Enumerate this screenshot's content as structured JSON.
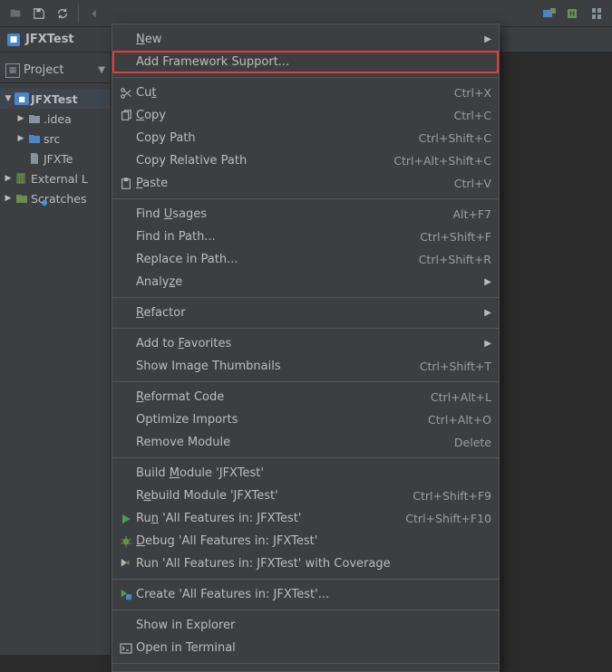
{
  "toolbar": {
    "right": [
      {
        "name": "tool-a"
      },
      {
        "name": "tool-b"
      },
      {
        "name": "tool-c"
      }
    ]
  },
  "breadcrumb": {
    "project": "JFXTest"
  },
  "sidebar": {
    "header": "Project",
    "tree": [
      {
        "label": "JFXTest",
        "kind": "module",
        "depth": 0,
        "expanded": true,
        "bold": true
      },
      {
        "label": ".idea",
        "kind": "folder",
        "depth": 1,
        "expanded": false
      },
      {
        "label": "src",
        "kind": "folder-src",
        "depth": 1,
        "expanded": false
      },
      {
        "label": "JFXTe",
        "kind": "file",
        "depth": 1
      },
      {
        "label": "External L",
        "kind": "libs",
        "depth": 0,
        "expanded": false
      },
      {
        "label": "Scratches",
        "kind": "scratch",
        "depth": 0,
        "expanded": false
      }
    ]
  },
  "contextMenu": {
    "items": [
      {
        "label": "New",
        "mnemonic": "N",
        "submenu": true
      },
      {
        "label": "Add Framework Support...",
        "highlighted": true
      },
      "sep",
      {
        "icon": "scissors",
        "label": "Cut",
        "mnemonic": "t",
        "shortcut": "Ctrl+X"
      },
      {
        "icon": "copy",
        "label": "Copy",
        "mnemonic": "C",
        "shortcut": "Ctrl+C"
      },
      {
        "label": "Copy Path",
        "mnemonic": "",
        "shortcut": "Ctrl+Shift+C"
      },
      {
        "label": "Copy Relative Path",
        "shortcut": "Ctrl+Alt+Shift+C"
      },
      {
        "icon": "paste",
        "label": "Paste",
        "mnemonic": "P",
        "shortcut": "Ctrl+V"
      },
      "sep",
      {
        "label": "Find Usages",
        "mnemonic": "U",
        "shortcut": "Alt+F7"
      },
      {
        "label": "Find in Path...",
        "mnemonic": "",
        "shortcut": "Ctrl+Shift+F"
      },
      {
        "label": "Replace in Path...",
        "mnemonic": "",
        "shortcut": "Ctrl+Shift+R"
      },
      {
        "label": "Analyze",
        "mnemonic": "z",
        "submenu": true
      },
      "sep",
      {
        "label": "Refactor",
        "mnemonic": "R",
        "submenu": true
      },
      "sep",
      {
        "label": "Add to Favorites",
        "mnemonic": "F",
        "submenu": true
      },
      {
        "label": "Show Image Thumbnails",
        "shortcut": "Ctrl+Shift+T"
      },
      "sep",
      {
        "label": "Reformat Code",
        "mnemonic": "R",
        "shortcut": "Ctrl+Alt+L"
      },
      {
        "label": "Optimize Imports",
        "mnemonic": "",
        "shortcut": "Ctrl+Alt+O"
      },
      {
        "label": "Remove Module",
        "shortcut": "Delete"
      },
      "sep",
      {
        "label": "Build Module 'JFXTest'",
        "mnemonic": "M"
      },
      {
        "label": "Rebuild Module 'JFXTest'",
        "mnemonic": "e",
        "shortcut": "Ctrl+Shift+F9"
      },
      {
        "icon": "run",
        "label": "Run 'All Features in: JFXTest'",
        "mnemonic": "n",
        "shortcut": "Ctrl+Shift+F10"
      },
      {
        "icon": "debug",
        "label": "Debug 'All Features in: JFXTest'",
        "mnemonic": "D"
      },
      {
        "icon": "coverage",
        "label": "Run 'All Features in: JFXTest' with Coverage"
      },
      "sep",
      {
        "icon": "create",
        "label": "Create 'All Features in: JFXTest'...",
        "mnemonic": ""
      },
      "sep",
      {
        "label": "Show in Explorer"
      },
      {
        "icon": "terminal",
        "label": "Open in Terminal"
      },
      "sep"
    ]
  }
}
